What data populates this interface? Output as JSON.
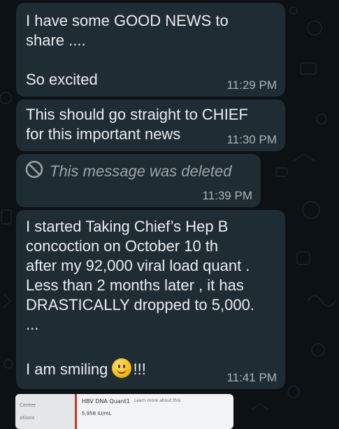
{
  "messages": [
    {
      "text": "I have some GOOD NEWS to\nshare ....\n\nSo excited",
      "time": "11:29 PM"
    },
    {
      "text": "This should go straight to CHIEF\nfor this important news",
      "time": "11:30 PM"
    },
    {
      "deleted_text": "This message was deleted",
      "time": "11:39 PM",
      "icon": "deleted-icon"
    },
    {
      "text": "I started Taking Chief’s Hep B\nconcoction on October 10 th\nafter my 92,000 viral load quant .\nLess than 2 months later , it has\nDRASTICALLY dropped to 5,000.\n...",
      "smile_prefix": "I am smiling ",
      "smile_suffix": "!!!",
      "time": "11:41 PM",
      "emoji": "smiling-face"
    }
  ],
  "attachment": {
    "title": "HBV DNA Quant1",
    "link": "Learn more about this",
    "value": "5,958 IU/mL",
    "side_label_1": "Center",
    "side_label_2": "ations"
  },
  "colors": {
    "background": "#0b1114",
    "bubble": "#1f2c33",
    "text": "#e9edef",
    "time": "#aab3b8"
  }
}
